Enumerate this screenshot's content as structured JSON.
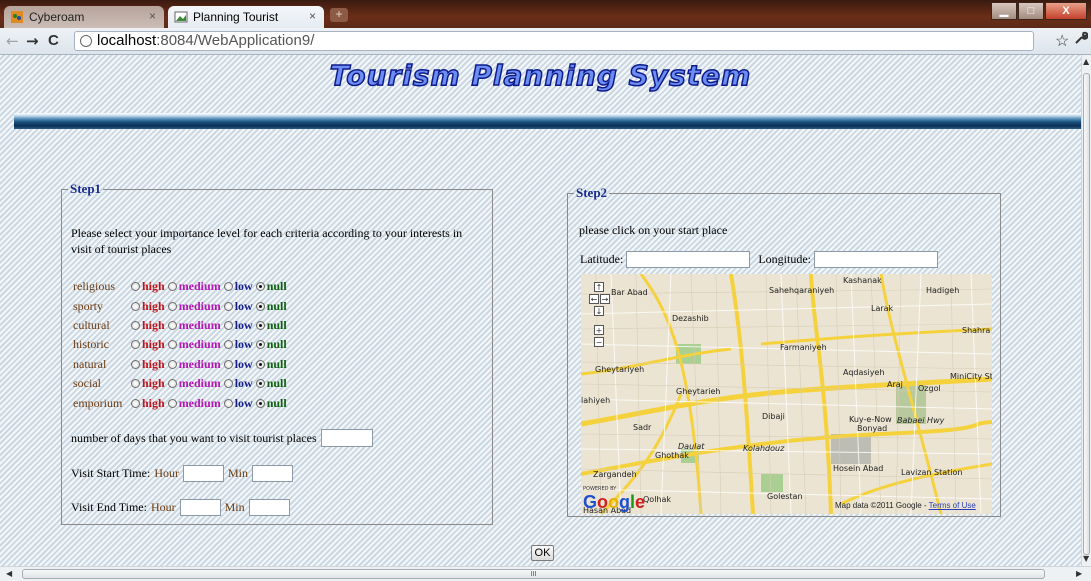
{
  "browser": {
    "tabs": [
      {
        "title": "Cyberoam",
        "active": false
      },
      {
        "title": "Planning Tourist",
        "active": true
      }
    ],
    "tab_close": "×",
    "new_tab": "+",
    "url_host": "localhost",
    "url_path": ":8084/WebApplication9/",
    "window_buttons": {
      "minimize": "▁",
      "maximize": "□",
      "close": "X"
    },
    "nav": {
      "back": "←",
      "forward": "→",
      "reload": "C"
    },
    "star": "☆",
    "wrench": "🔧"
  },
  "page": {
    "title": "Tourism Planning System",
    "accent_color": "#1a2c8c"
  },
  "step1": {
    "legend": "Step1",
    "instructions": "Please select your importance level for each criteria according to your interests in visit of tourist places",
    "levels": [
      "high",
      "medium",
      "low",
      "null"
    ],
    "criteria": [
      {
        "name": "religious",
        "selected": "null"
      },
      {
        "name": "sporty",
        "selected": "null"
      },
      {
        "name": "cultural",
        "selected": "null"
      },
      {
        "name": "historic",
        "selected": "null"
      },
      {
        "name": "natural",
        "selected": "null"
      },
      {
        "name": "social",
        "selected": "null"
      },
      {
        "name": "emporium",
        "selected": "null"
      }
    ],
    "days_label": "number of days that you want to visit tourist places",
    "days_value": "",
    "start_label": "Visit Start Time:",
    "end_label": "Visit End Time:",
    "hour_label": "Hour",
    "min_label": "Min",
    "start_hour": "",
    "start_min": "",
    "end_hour": "",
    "end_min": ""
  },
  "step2": {
    "legend": "Step2",
    "instructions": "please click on your start place",
    "latitude_label": "Latitude:",
    "longitude_label": "Longitude:",
    "latitude_value": "",
    "longitude_value": "",
    "map": {
      "labels": [
        "Sahehqaraniyeh",
        "Kashanak",
        "Hadigeh",
        "Larak",
        "Shahra",
        "Dezashib",
        "Farmaniyeh",
        "Aqdasiyeh",
        "Araj",
        "Ozgol",
        "MiniCity St",
        "Gheytariyeh",
        "Gheytarieh",
        "Dibaji",
        "Kuy-e-Now",
        "Bonyad",
        "Babaei Hwy",
        "Sadr",
        "Ghothak",
        "Kolahdouz",
        "Lavizan Station",
        "Zargandeh",
        "Hosein Abad",
        "Golestan",
        "Daulat",
        "Bar Abad",
        "lahiyeh",
        "Qolhak",
        "Hasan Abad"
      ],
      "zoom_controls": {
        "up": "↑",
        "left": "←",
        "right": "→",
        "down": "↓",
        "plus": "+",
        "minus": "−"
      },
      "powered_by": "POWERED BY",
      "logo": [
        "G",
        "o",
        "o",
        "g",
        "l",
        "e"
      ],
      "attribution": "Map data ©2011 Google - ",
      "terms": "Terms of Use"
    }
  },
  "ok_button": "OK",
  "scroll": {
    "grip": "III",
    "up": "▲",
    "down": "▼",
    "left": "◀",
    "right": "▶"
  }
}
